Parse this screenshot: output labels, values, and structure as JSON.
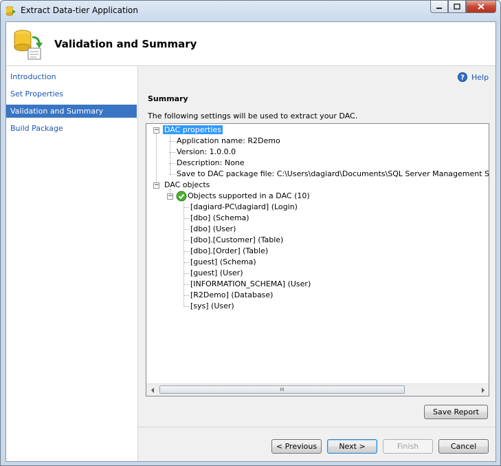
{
  "window": {
    "title": "Extract Data-tier Application"
  },
  "header": {
    "title": "Validation and Summary"
  },
  "nav": {
    "items": [
      {
        "label": "Introduction"
      },
      {
        "label": "Set Properties"
      },
      {
        "label": "Validation and Summary",
        "selected": true
      },
      {
        "label": "Build Package"
      }
    ]
  },
  "help": {
    "label": "Help"
  },
  "summary": {
    "heading": "Summary",
    "description": "The following settings will be used to extract your DAC."
  },
  "tree": {
    "dac_properties": {
      "label": "DAC properties",
      "children": [
        "Application name: R2Demo",
        "Version: 1.0.0.0",
        "Description: None",
        "Save to DAC package file: C:\\Users\\dagiard\\Documents\\SQL Server Management Studio\\DAC"
      ]
    },
    "dac_objects": {
      "label": "DAC objects",
      "group_label": "Objects supported in a DAC (10)",
      "children": [
        "[dagiard-PC\\dagiard] (Login)",
        "[dbo] (Schema)",
        "[dbo] (User)",
        "[dbo].[Customer] (Table)",
        "[dbo].[Order] (Table)",
        "[guest] (Schema)",
        "[guest] (User)",
        "[INFORMATION_SCHEMA] (User)",
        "[R2Demo] (Database)",
        "[sys] (User)"
      ]
    }
  },
  "scrollbar": {
    "grip": "III"
  },
  "buttons": {
    "save_report": "Save Report",
    "previous": "< Previous",
    "next": "Next >",
    "finish": "Finish",
    "cancel": "Cancel"
  },
  "colors": {
    "selection": "#3a75c4",
    "link": "#1a55b0",
    "tree_highlight": "#3399ff"
  }
}
